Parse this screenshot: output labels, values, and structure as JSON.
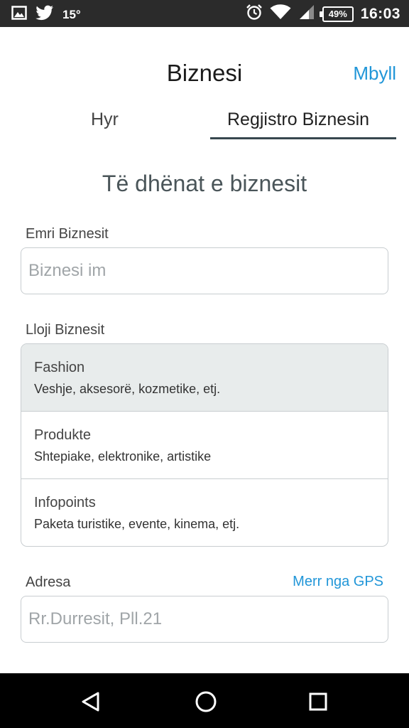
{
  "status_bar": {
    "temperature": "15°",
    "battery": "49%",
    "time": "16:03",
    "icons": [
      "gallery-icon",
      "twitter-icon",
      "alarm-icon",
      "wifi-icon",
      "signal-icon",
      "battery-icon"
    ]
  },
  "header": {
    "title": "Biznesi",
    "close_label": "Mbyll"
  },
  "tabs": [
    {
      "label": "Hyr",
      "active": false
    },
    {
      "label": "Regjistro Biznesin",
      "active": true
    }
  ],
  "section_title": "Të dhënat e biznesit",
  "business_name": {
    "label": "Emri Biznesit",
    "placeholder": "Biznesi im"
  },
  "business_type": {
    "label": "Lloji Biznesit",
    "options": [
      {
        "name": "Fashion",
        "description": "Veshje, aksesorë, kozmetike, etj.",
        "selected": true
      },
      {
        "name": "Produkte",
        "description": "Shtepiake, elektronike, artistike",
        "selected": false
      },
      {
        "name": "Infopoints",
        "description": "Paketa turistike, evente, kinema, etj.",
        "selected": false
      }
    ]
  },
  "address": {
    "label": "Adresa",
    "gps_label": "Merr nga GPS",
    "placeholder": "Rr.Durresit, Pll.21"
  },
  "colors": {
    "accent": "#2196d8",
    "tab_underline": "#37474f",
    "selected_bg": "#e8ecec",
    "status_bar": "#2b2b2b",
    "nav_bar": "#000000"
  }
}
